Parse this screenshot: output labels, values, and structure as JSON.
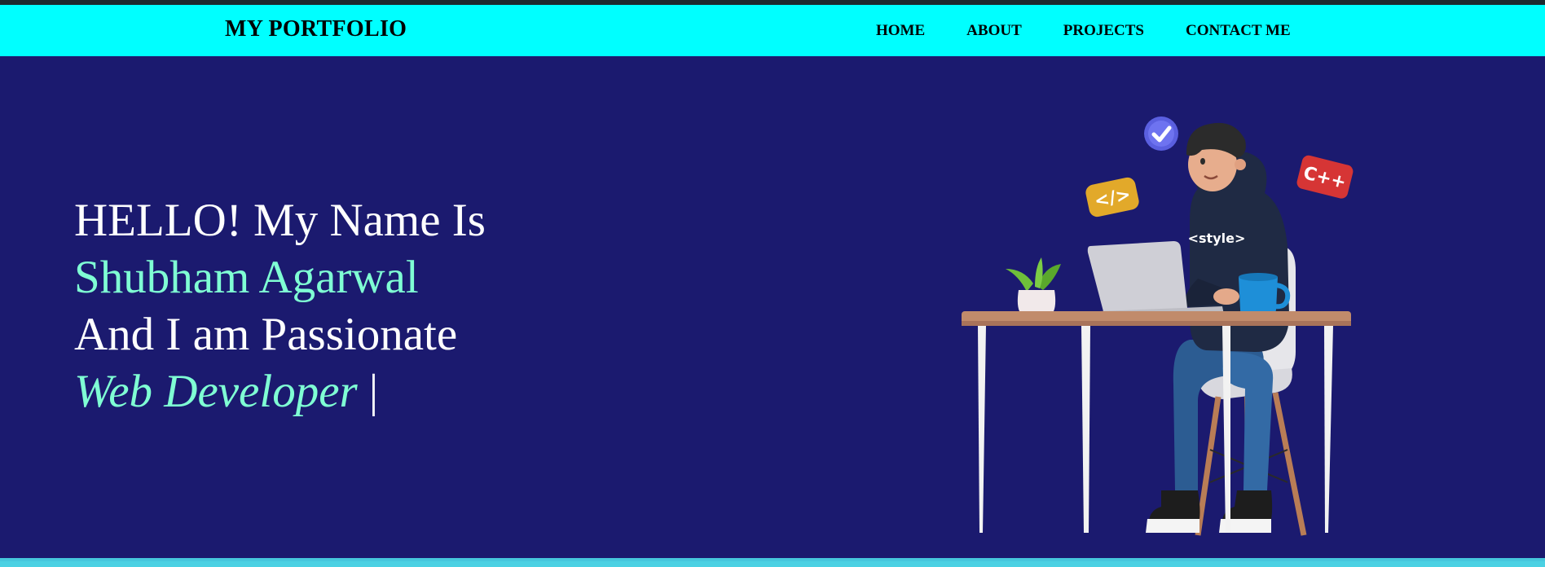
{
  "header": {
    "brand": "MY PORTFOLIO",
    "nav": [
      {
        "label": "HOME"
      },
      {
        "label": "ABOUT"
      },
      {
        "label": "PROJECTS"
      },
      {
        "label": "CONTACT ME"
      }
    ]
  },
  "hero": {
    "greeting": "HELLO! My Name Is",
    "name": "Shubham Agarwal",
    "tagline": "And I am Passionate",
    "role": "Web Developer",
    "cursor": "|"
  },
  "illustration": {
    "hoodie_text": "<style>",
    "code_badge": "</>",
    "cpp_badge": "C++"
  },
  "colors": {
    "background": "#1b1a6f",
    "navbar": "#00ffff",
    "accent": "#7fffd4",
    "text": "#ffffff"
  }
}
